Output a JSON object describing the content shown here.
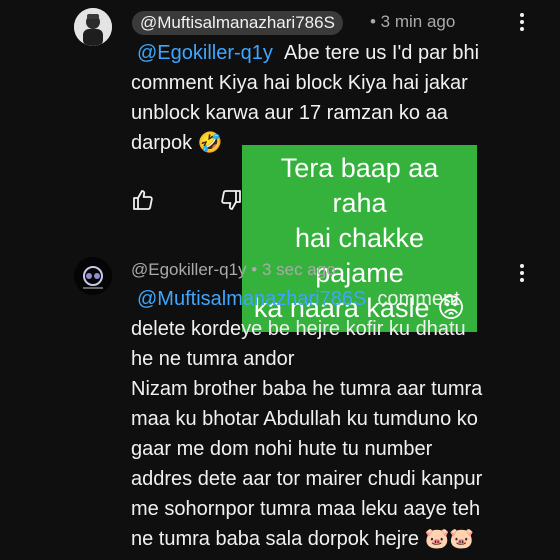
{
  "comment1": {
    "author": "@Muftisalmanazhari786S",
    "time": "• 3 min ago",
    "mention": "@Egokiller-q1y",
    "line1_rest": "Abe tere us I'd par bhi",
    "line2": "comment Kiya hai block Kiya hai jakar",
    "line3": "unblock karwa aur 17 ramzan ko aa",
    "line4": "darpok 🤣"
  },
  "overlay": {
    "line1": "Tera baap aa raha",
    "line2": "hai chakke pajame",
    "line3": "ka naara kasle 😡"
  },
  "comment2": {
    "author": "@Egokiller-q1y",
    "time": "• 3 sec ago",
    "mention": "@Muftisalmanazhari786S",
    "line1_rest": "comment",
    "line2": "delete kordeye be hejre kofir ku dhatu",
    "line3": "he ne tumra andor",
    "line4": "Nizam brother baba he tumra aar tumra",
    "line5": "maa ku bhotar Abdullah ku tumduno ko",
    "line6": "gaar me dom nohi hute tu number",
    "line7": "addres dete aar tor mairer chudi kanpur",
    "line8": "me sohornpor tumra maa leku aaye teh",
    "line9": "ne tumra baba sala dorpok  hejre 🐷🐷"
  },
  "icons": {
    "like": "thumbs-up-icon",
    "dislike": "thumbs-down-icon",
    "menu": "more-vert-icon"
  },
  "colors": {
    "background": "#0f0f0f",
    "mention": "#3ea6ff",
    "overlay": "#35b23c"
  }
}
